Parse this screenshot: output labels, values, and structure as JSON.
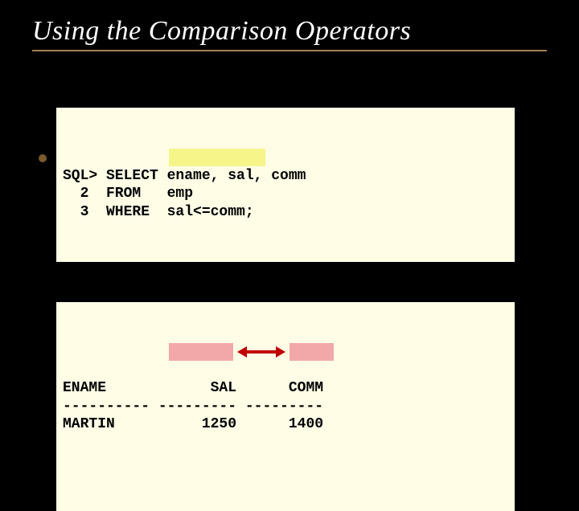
{
  "title": "Using the Comparison Operators",
  "query": {
    "line1": "SQL> SELECT ename, sal, comm",
    "line2": "  2  FROM   emp",
    "line3": "  3  WHERE  sal<=comm;"
  },
  "result": {
    "header": "ENAME            SAL      COMM",
    "divider": "---------- --------- ---------",
    "row": "MARTIN          1250      1400"
  }
}
